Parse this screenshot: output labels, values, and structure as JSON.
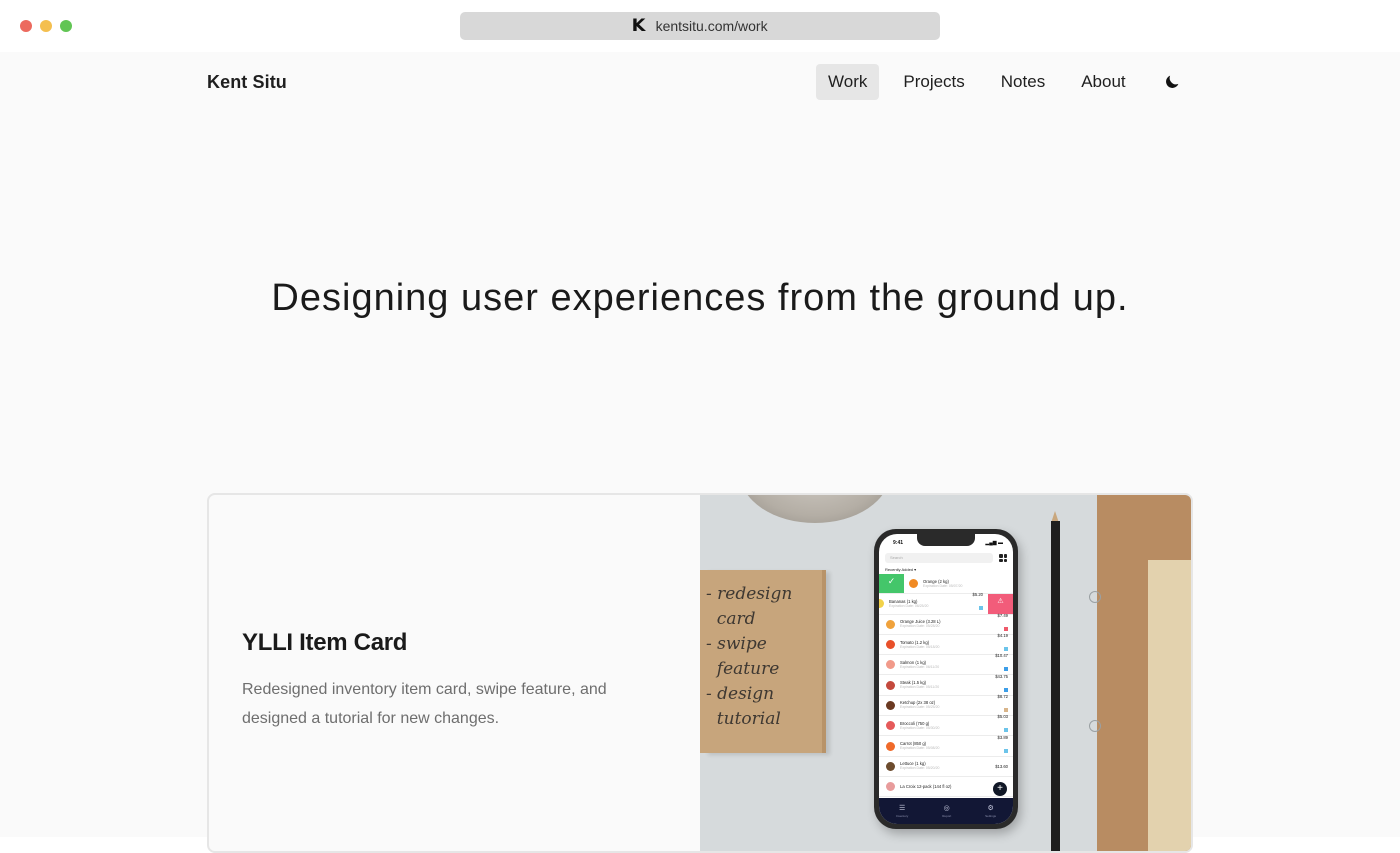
{
  "browser": {
    "url": "kentsitu.com/work",
    "favicon_letter": "K"
  },
  "header": {
    "site_title": "Kent Situ",
    "nav": [
      {
        "label": "Work",
        "active": true
      },
      {
        "label": "Projects",
        "active": false
      },
      {
        "label": "Notes",
        "active": false
      },
      {
        "label": "About",
        "active": false
      }
    ],
    "theme_toggle_icon": "moon-icon"
  },
  "hero": {
    "headline": "Designing user experiences from the ground up."
  },
  "work_card": {
    "title": "YLLI Item Card",
    "description": "Redesigned inventory item card, swipe feature, and designed a tutorial for new changes.",
    "image": {
      "notepad_lines": [
        "- redesign",
        "  card",
        "- swipe",
        "  feature",
        "- design",
        "  tutorial"
      ],
      "phone": {
        "time": "9:41",
        "search_placeholder": "Search",
        "sort_label": "Recently Added ▾",
        "items": [
          {
            "name": "Orange (2 kg)",
            "sub": "Expiration Date: 05/07/20",
            "price": "",
            "thumb": "#f08a24",
            "tag": "",
            "swipe": "left"
          },
          {
            "name": "Bananas (1 kg)",
            "sub": "Expiration Date: 06/25/20",
            "price": "$5.20",
            "thumb": "#f2d24a",
            "tag": "#6cc4ea",
            "swipe": "right"
          },
          {
            "name": "Orange Juice (3.28 L)",
            "sub": "Expiration Date: 05/28/20",
            "price": "$7.49",
            "thumb": "#f0a23c",
            "tag": "#ef5a6b"
          },
          {
            "name": "Tomato (1.2 kg)",
            "sub": "Expiration Date: 05/18/20",
            "price": "$4.19",
            "thumb": "#e8502a",
            "tag": "#6cc4ea"
          },
          {
            "name": "Salmon (1 kg)",
            "sub": "Expiration Date: 06/11/20",
            "price": "$10.47",
            "thumb": "#f19a8a",
            "tag": "#3d9ee8"
          },
          {
            "name": "Steak (1.5 kg)",
            "sub": "Expiration Date: 05/11/20",
            "price": "$43.75",
            "thumb": "#c4493d",
            "tag": "#3d9ee8"
          },
          {
            "name": "Ketchup (2x 38 oz)",
            "sub": "Expiration Date: 05/25/20",
            "price": "$8.72",
            "thumb": "#6b3a22",
            "tag": "#d9b58a"
          },
          {
            "name": "Broccoli (750 g)",
            "sub": "Expiration Date: 05/30/20",
            "price": "$5.03",
            "thumb": "#e55a5a",
            "tag": "#6cc4ea"
          },
          {
            "name": "Carrot (850 g)",
            "sub": "Expiration Date: 05/08/20",
            "price": "$3.89",
            "thumb": "#f06a2a",
            "tag": "#6cc4ea"
          },
          {
            "name": "Lettuce (1 kg)",
            "sub": "Expiration Date: 05/20/20",
            "price": "$13.60",
            "thumb": "#6d4c2e",
            "tag": ""
          },
          {
            "name": "La Croix 12-pack (144 fl oz)",
            "sub": "",
            "price": "",
            "thumb": "#e89c9c",
            "tag": ""
          }
        ],
        "fab_label": "+",
        "tabs": [
          {
            "label": "Inventory",
            "icon": "list-icon"
          },
          {
            "label": "Report",
            "icon": "chart-icon"
          },
          {
            "label": "Settings",
            "icon": "gear-icon"
          }
        ]
      }
    }
  }
}
